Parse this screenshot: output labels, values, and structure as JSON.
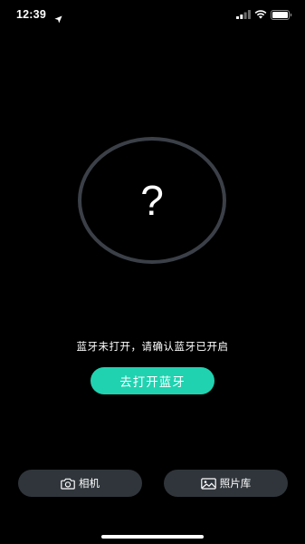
{
  "status_bar": {
    "time": "12:39",
    "icons": [
      "location-arrow-icon",
      "signal-icon",
      "wifi-icon",
      "battery-icon"
    ]
  },
  "status_graphic": {
    "symbol": "?",
    "ring_color": "#3b4048"
  },
  "message": "蓝牙未打开，请确认蓝牙已开启",
  "primary_button": {
    "label": "去打开蓝牙",
    "color": "#20d2b0"
  },
  "bottom_bar": {
    "camera_label": "相机",
    "camera_icon": "camera-icon",
    "album_label": "照片库",
    "album_icon": "image-icon",
    "button_color": "#2f353b"
  },
  "colors": {
    "background": "#000000",
    "text": "#ffffff"
  }
}
